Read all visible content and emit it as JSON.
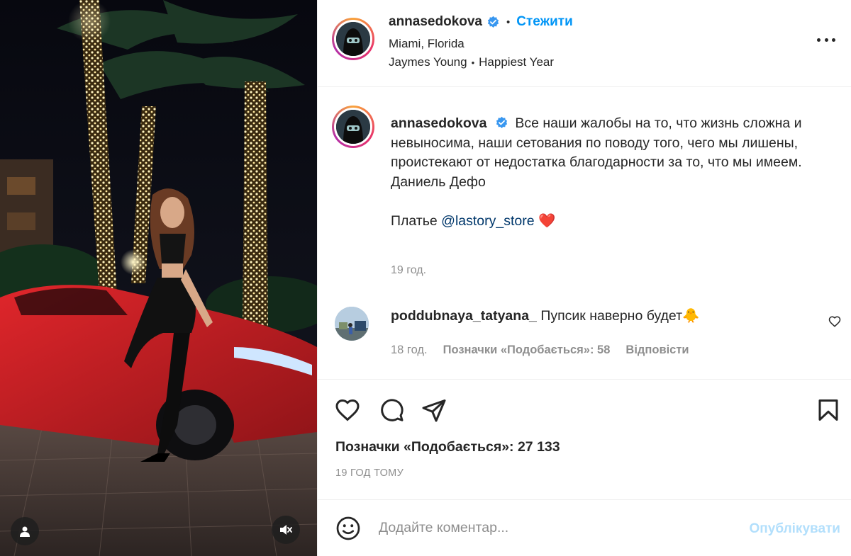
{
  "post_author": {
    "username": "annasedokova",
    "verified": true,
    "follow_label": "Стежити",
    "location": "Miami, Florida",
    "music_artist": "Jaymes Young",
    "music_track": "Happiest Year"
  },
  "caption": {
    "username": "annasedokova",
    "text": "Все наши жалобы на то, что жизнь сложна и невыносима, наши сетования по поводу того, чего мы лишены, проистекают от недостатка благодарности за то, что мы имеем.",
    "author_line": "Даниель Дефо",
    "dress_prefix": "Платье",
    "mention": "@lastory_store",
    "emoji": "❤️",
    "time": "19 год."
  },
  "comments": [
    {
      "username": "poddubnaya_tatyana_",
      "text": "Пупсик наверно будет🐥",
      "time": "18 год.",
      "likes_label": "Позначки «Подобається»: 58",
      "reply_label": "Відповісти"
    }
  ],
  "actions": {
    "likes_label": "Позначки «Подобається»: 27 133",
    "time_ago": "19 ГОД ТОМУ"
  },
  "comment_input": {
    "placeholder": "Додайте коментар...",
    "post_label": "Опублікувати"
  },
  "colors": {
    "accent": "#0095f6",
    "post_disabled": "#b2dffc",
    "muted_text": "#8e8e8e",
    "mention": "#00376b",
    "car_red": "#c81d22"
  },
  "icons": [
    "verified-icon",
    "more-icon",
    "heart-icon",
    "comment-icon",
    "share-icon",
    "bookmark-icon",
    "emoji-icon",
    "tag-user-icon",
    "mute-icon"
  ]
}
